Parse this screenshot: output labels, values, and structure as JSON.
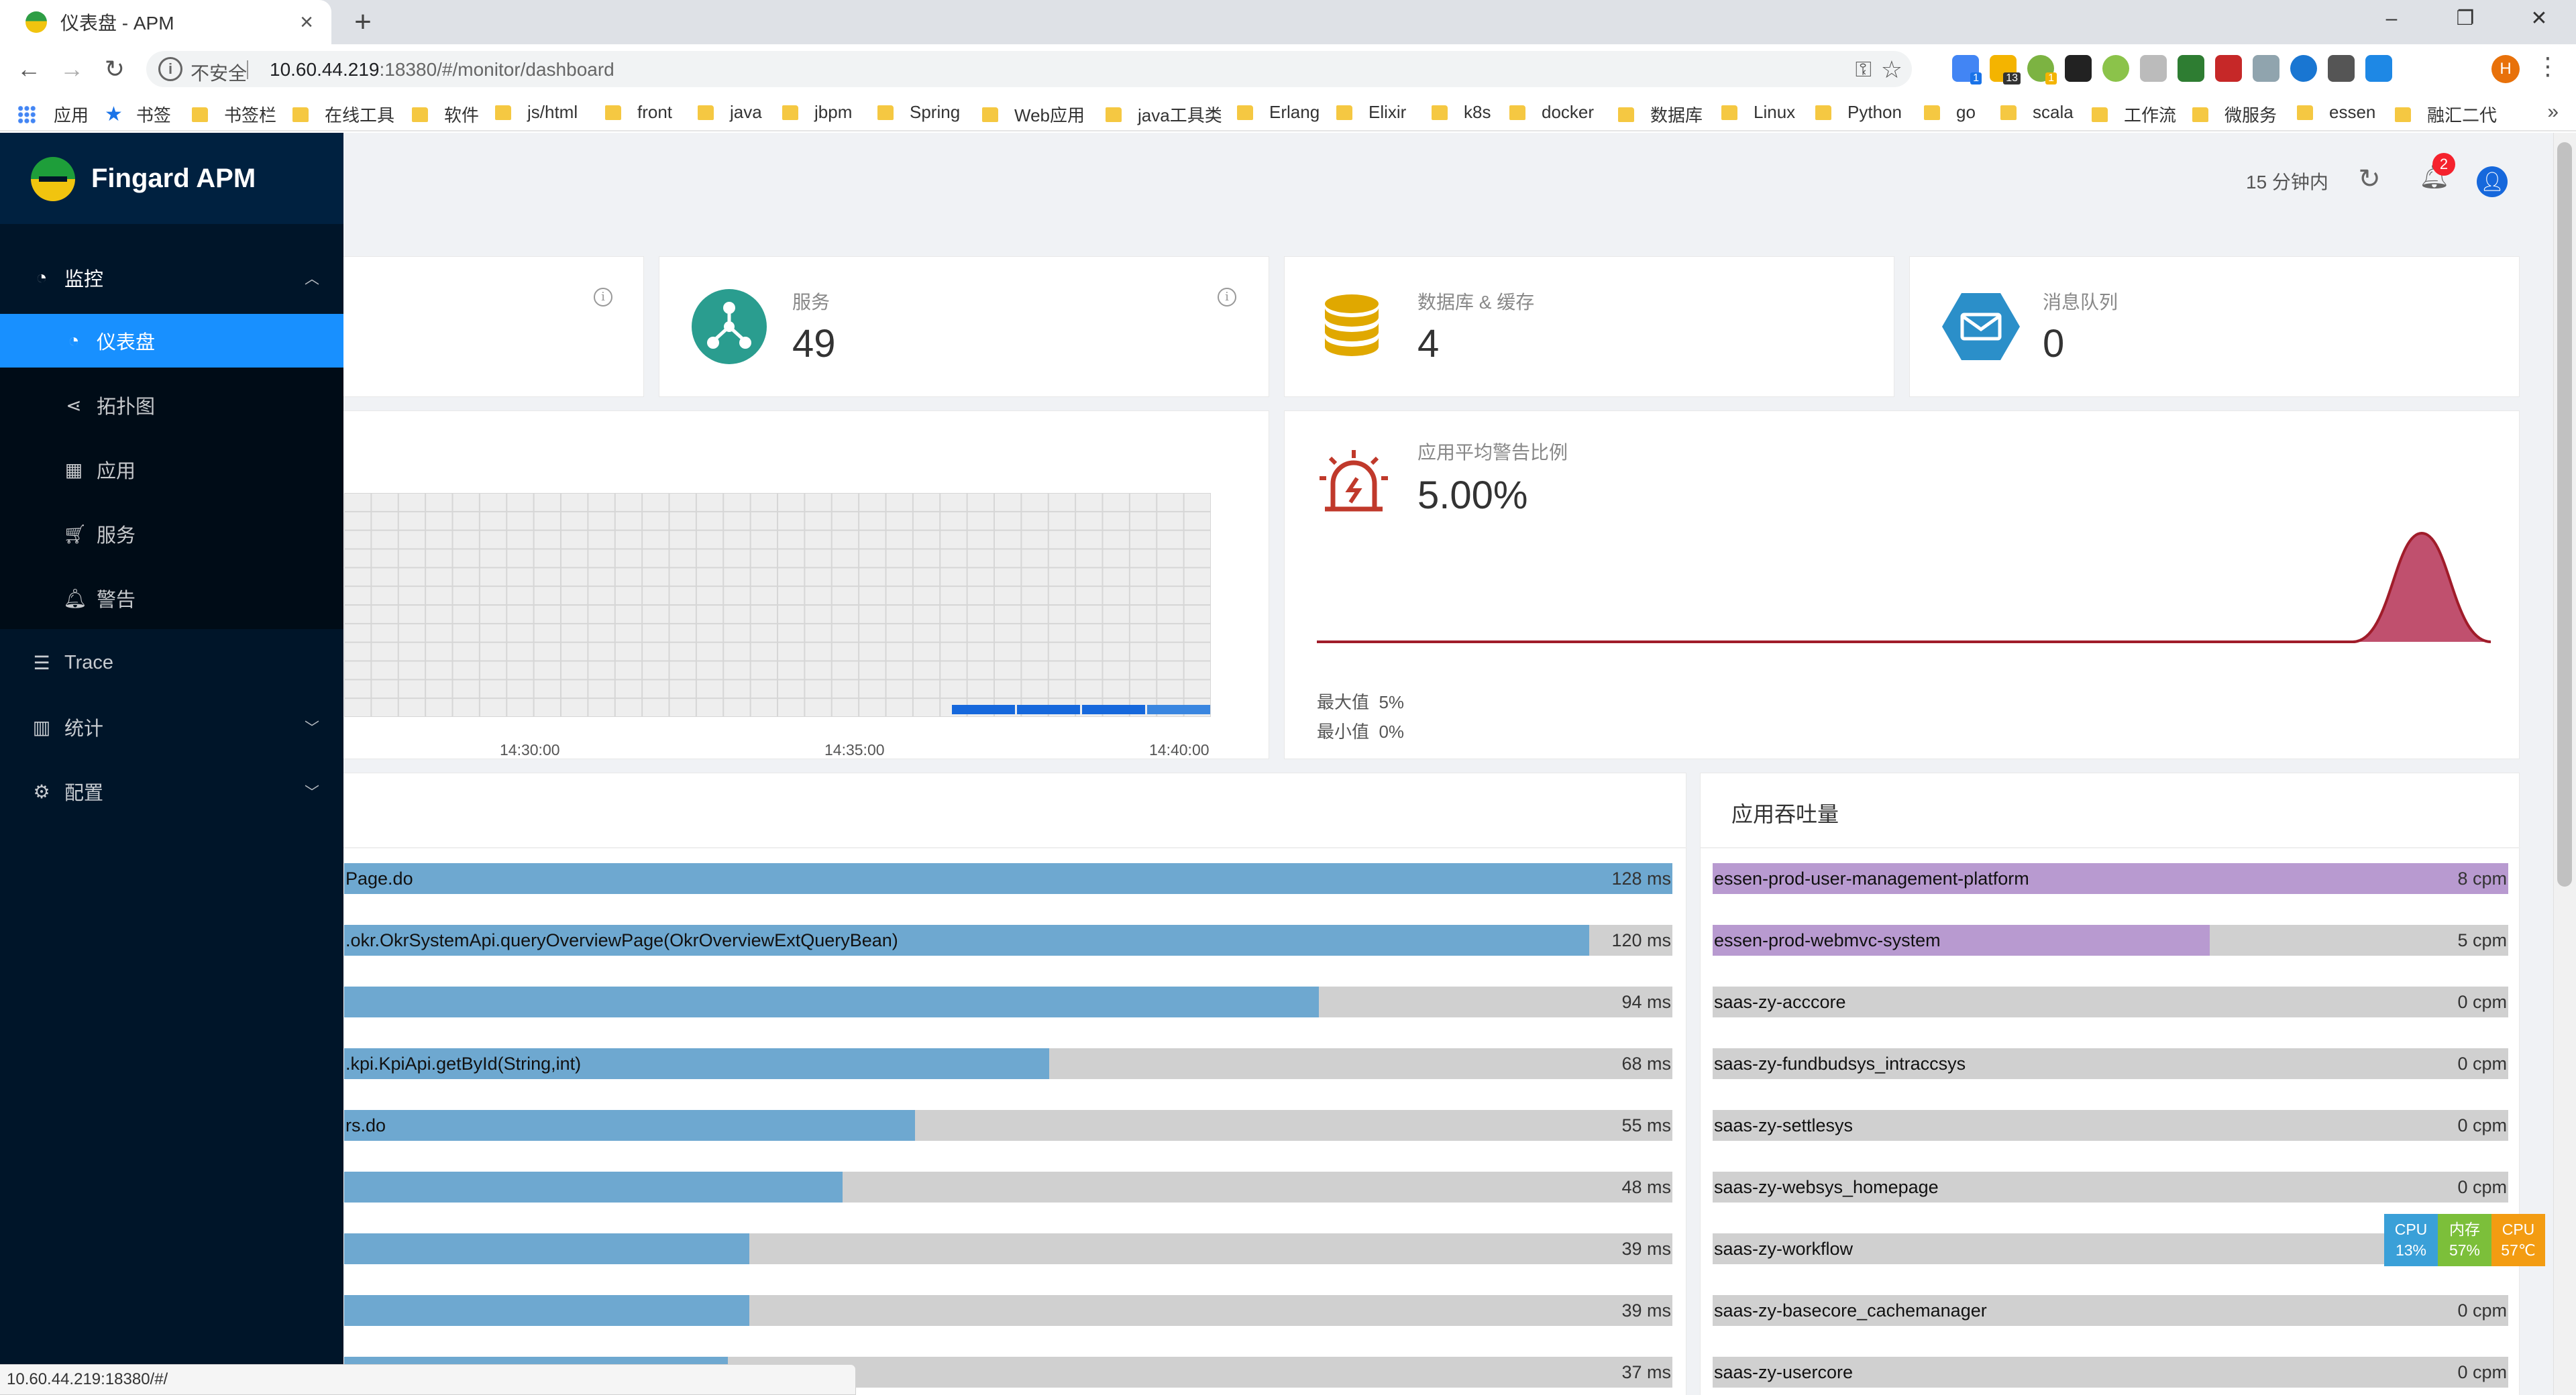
{
  "browser": {
    "tab_title": "仪表盘 - APM",
    "insecure_label": "不安全",
    "url_host": "10.60.44.219",
    "url_path": ":18380/#/monitor/dashboard",
    "status_url": "10.60.44.219:18380/#/",
    "ext_badges": {
      "ext1": "1",
      "ext2": "13",
      "ext3": "1"
    },
    "avatar_letter": "H",
    "bookmarks": [
      "应用",
      "书签",
      "书签栏",
      "在线工具",
      "软件",
      "js/html",
      "front",
      "java",
      "jbpm",
      "Spring",
      "Web应用",
      "java工具类",
      "Erlang",
      "Elixir",
      "k8s",
      "docker",
      "数据库",
      "Linux",
      "Python",
      "go",
      "scala",
      "工作流",
      "微服务",
      "essen",
      "融汇二代"
    ]
  },
  "brand": {
    "name": "Fingard APM"
  },
  "header": {
    "time_range": "15 分钟内",
    "notification_count": "2"
  },
  "sidebar": {
    "monitor": "监控",
    "monitor_children": [
      "仪表盘",
      "拓扑图",
      "应用",
      "服务",
      "警告"
    ],
    "trace": "Trace",
    "stats": "统计",
    "config": "配置"
  },
  "cards": {
    "services": {
      "label": "服务",
      "value": "49"
    },
    "db_cache": {
      "label": "数据库 & 缓存",
      "value": "4"
    },
    "mq": {
      "label": "消息队列",
      "value": "0"
    }
  },
  "left_chart": {
    "x_ticks": [
      "14:30:00",
      "14:35:00",
      "14:40:00"
    ]
  },
  "alert_panel": {
    "label": "应用平均警告比例",
    "value": "5.00%",
    "max_label": "最大值",
    "max_value": "5%",
    "min_label": "最小值",
    "min_value": "0%"
  },
  "chart_data": {
    "type": "area",
    "values": [
      0,
      0,
      0,
      0,
      0,
      0,
      0,
      0,
      0,
      0,
      0,
      0,
      0,
      0,
      0,
      0,
      5,
      0
    ],
    "ylim": [
      0,
      5
    ]
  },
  "response_list": {
    "rows": [
      {
        "label": "Page.do",
        "value": "128 ms",
        "ratio": 1.0
      },
      {
        "label": ".okr.OkrSystemApi.queryOverviewPage(OkrOverviewExtQueryBean)",
        "value": "120 ms",
        "ratio": 0.9375
      },
      {
        "label": "",
        "value": "94 ms",
        "ratio": 0.734
      },
      {
        "label": ".kpi.KpiApi.getById(String,int)",
        "value": "68 ms",
        "ratio": 0.531
      },
      {
        "label": "rs.do",
        "value": "55 ms",
        "ratio": 0.43
      },
      {
        "label": "",
        "value": "48 ms",
        "ratio": 0.375
      },
      {
        "label": "",
        "value": "39 ms",
        "ratio": 0.305
      },
      {
        "label": "",
        "value": "39 ms",
        "ratio": 0.305
      },
      {
        "label": "",
        "value": "37 ms",
        "ratio": 0.289
      }
    ]
  },
  "throughput_list": {
    "title": "应用吞吐量",
    "rows": [
      {
        "label": "essen-prod-user-management-platform",
        "value": "8 cpm",
        "ratio": 1.0
      },
      {
        "label": "essen-prod-webmvc-system",
        "value": "5 cpm",
        "ratio": 0.625
      },
      {
        "label": "saas-zy-acccore",
        "value": "0 cpm",
        "ratio": 0
      },
      {
        "label": "saas-zy-fundbudsys_intraccsys",
        "value": "0 cpm",
        "ratio": 0
      },
      {
        "label": "saas-zy-settlesys",
        "value": "0 cpm",
        "ratio": 0
      },
      {
        "label": "saas-zy-websys_homepage",
        "value": "0 cpm",
        "ratio": 0
      },
      {
        "label": "saas-zy-workflow",
        "value": "",
        "ratio": 0
      },
      {
        "label": "saas-zy-basecore_cachemanager",
        "value": "0 cpm",
        "ratio": 0
      },
      {
        "label": "saas-zy-usercore",
        "value": "0 cpm",
        "ratio": 0
      }
    ]
  },
  "sysmon": {
    "cpu_label": "CPU",
    "cpu_value": "13%",
    "mem_label": "内存",
    "mem_value": "57%",
    "temp_label": "CPU",
    "temp_value": "57℃"
  },
  "colors": {
    "sidebar_bg": "#001529",
    "active": "#1890ff",
    "response_bar": "#6ea8d0",
    "throughput_bar": "#b89ad0",
    "alert_area": "#c0506e",
    "alert_line": "#a01c2a"
  }
}
